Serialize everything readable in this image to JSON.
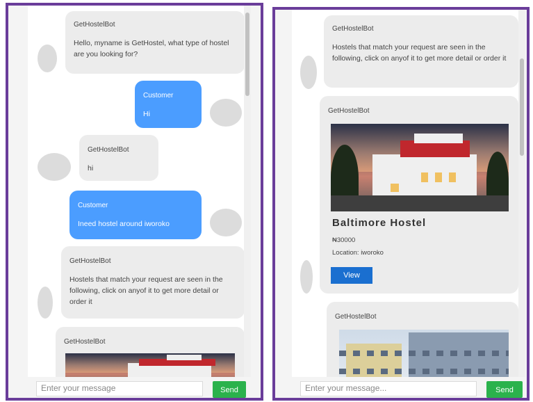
{
  "colors": {
    "frame": "#6a3d9a",
    "user_bubble": "#4b9dff",
    "bot_bubble": "#ececec",
    "view_button": "#1a6fd0",
    "send_button": "#2bb24c"
  },
  "left": {
    "messages": [
      {
        "role": "bot",
        "sender": "GetHostelBot",
        "text": "Hello, myname is GetHostel, what type of hostel are you looking for?"
      },
      {
        "role": "user",
        "sender": "Customer",
        "text": "Hi"
      },
      {
        "role": "bot",
        "sender": "GetHostelBot",
        "text": "hi"
      },
      {
        "role": "user",
        "sender": "Customer",
        "text": "Ineed hostel around iworoko"
      },
      {
        "role": "bot",
        "sender": "GetHostelBot",
        "text": "Hostels that match your request are seen in the following, click on anyof it to get more detail or order it"
      },
      {
        "role": "bot",
        "sender": "GetHostelBot",
        "text": ""
      }
    ],
    "input_placeholder": "Enter your message",
    "send_label": "Send"
  },
  "right": {
    "messages": [
      {
        "role": "bot",
        "sender": "GetHostelBot",
        "text": "Hostels that match your request are seen in the following, click on anyof it to get more detail or order it"
      }
    ],
    "hostel_card": {
      "sender": "GetHostelBot",
      "name": "Baltimore Hostel",
      "price": "₦30000",
      "location": "Location: iworoko",
      "view_label": "View"
    },
    "second_card": {
      "sender": "GetHostelBot"
    },
    "input_placeholder": "Enter your message...",
    "send_label": "Send"
  }
}
